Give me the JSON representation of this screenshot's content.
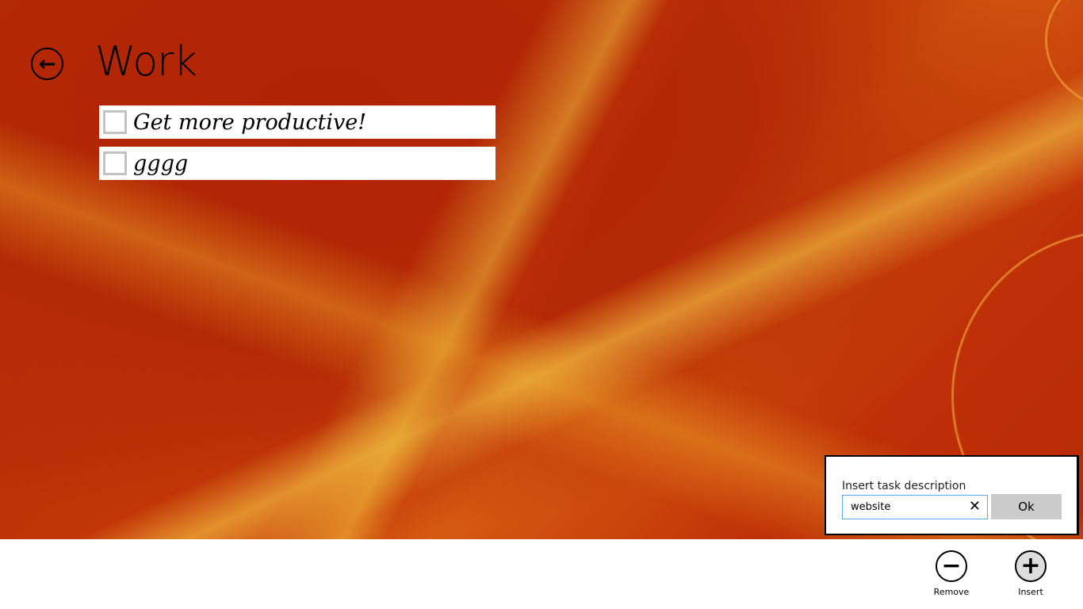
{
  "header": {
    "title": "Work",
    "back_icon": "back-arrow-icon"
  },
  "tasks": [
    {
      "label": "Get more productive!",
      "checked": false
    },
    {
      "label": "gggg",
      "checked": false
    }
  ],
  "dialog": {
    "label": "Insert task description",
    "value": "website",
    "clear_symbol": "✕",
    "ok_label": "Ok"
  },
  "appbar": {
    "remove_label": "Remove",
    "remove_symbol": "−",
    "insert_label": "Insert",
    "insert_symbol": "+"
  }
}
